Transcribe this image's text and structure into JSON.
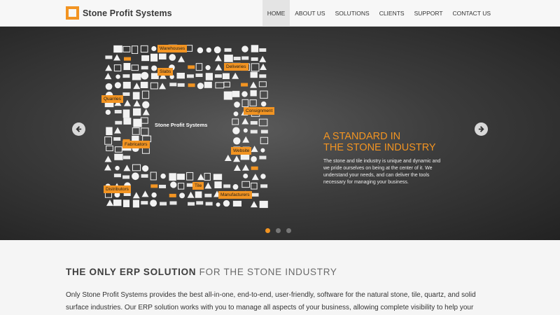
{
  "header": {
    "logo_text": "Stone Profit Systems",
    "nav": [
      "HOME",
      "ABOUT US",
      "SOLUTIONS",
      "CLIENTS",
      "SUPPORT",
      "CONTACT US"
    ],
    "active_nav": "HOME"
  },
  "hero": {
    "collage_title": "Stone Profit Systems",
    "tags": [
      "Warehouses",
      "Slabs",
      "Deliveries",
      "Quarries",
      "Consignment",
      "Fabricators",
      "Website",
      "Distributors",
      "Tile",
      "Manufacturers"
    ],
    "title_line1": "A STANDARD IN",
    "title_line2": "THE STONE INDUSTRY",
    "body": "The stone and tile industry is unique and dynamic and we pride ourselves on being at the center of it. We understand your needs, and can deliver the tools necessary for managing your business.",
    "slide_count": 3,
    "active_slide": 1
  },
  "intro": {
    "title_bold": "THE ONLY ERP SOLUTION",
    "title_rest": " FOR THE STONE INDUSTRY",
    "body": "Only Stone Profit Systems provides the best all-in-one, end-to-end, user-friendly, software for the natural stone, tile, quartz, and solid surface industries. Our ERP solution works with you to manage all aspects of your business, allowing complete visibility to help your"
  },
  "colors": {
    "accent": "#f29422",
    "hero_dark": "#2a2a2a"
  },
  "icons": [
    "chevron-left-icon",
    "chevron-right-icon",
    "logo-mark-icon"
  ]
}
